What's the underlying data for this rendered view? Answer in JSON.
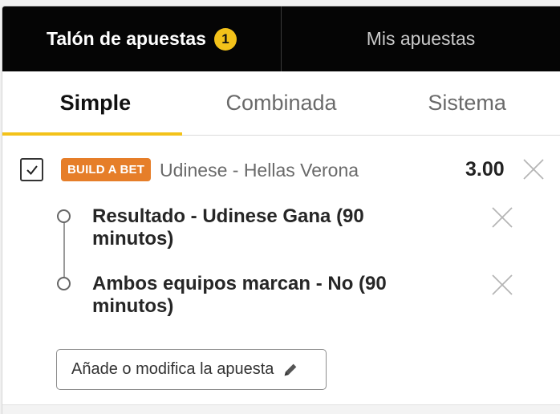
{
  "top_tabs": {
    "betslip_label": "Talón de apuestas",
    "betslip_count": "1",
    "my_bets_label": "Mis apuestas"
  },
  "sub_tabs": [
    "Simple",
    "Combinada",
    "Sistema"
  ],
  "active_sub_tab": "Simple",
  "bet": {
    "checked": true,
    "badge": "BUILD A BET",
    "match": "Udinese - Hellas Verona",
    "odds": "3.00",
    "selections": [
      {
        "text": "Resultado - Udinese Gana (90 minutos)"
      },
      {
        "text": "Ambos equipos marcan - No (90 minutos)"
      }
    ],
    "edit_button": "Añade o modifica la apuesta"
  },
  "colors": {
    "accent_yellow": "#f3c21a",
    "badge_orange": "#e67e29",
    "header_black": "#050505"
  },
  "icons": {
    "close": "close-icon",
    "edit": "pencil-icon",
    "check": "check-icon"
  }
}
